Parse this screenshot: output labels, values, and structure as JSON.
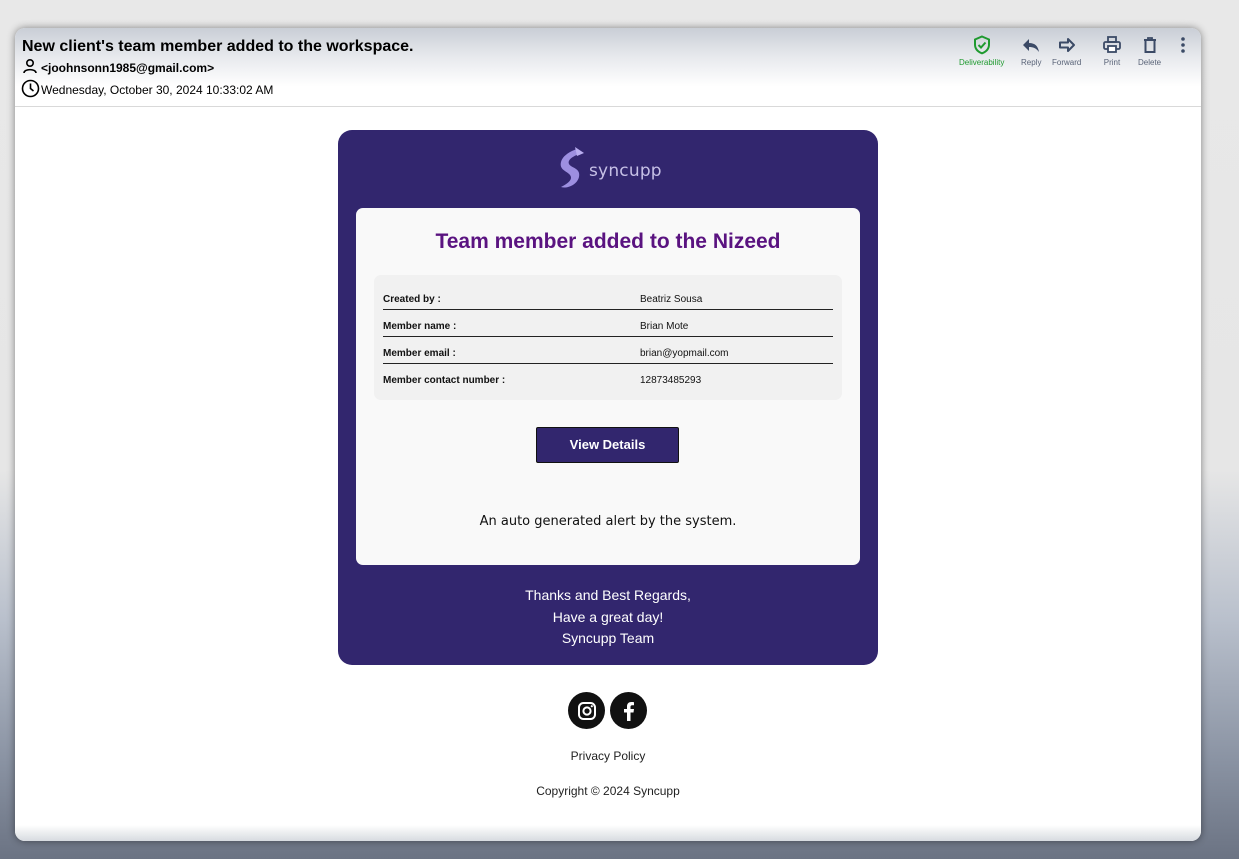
{
  "email": {
    "subject": "New client's team member added to the workspace.",
    "from": "<joohnsonn1985@gmail.com>",
    "date": "Wednesday, October 30, 2024 10:33:02 AM"
  },
  "toolbar": {
    "deliverability": "Deliverability",
    "reply": "Reply",
    "forward": "Forward",
    "print": "Print",
    "delete": "Delete"
  },
  "body": {
    "logo_text": "syncupp",
    "title": "Team member added to the Nizeed",
    "details": [
      {
        "label": "Created by :",
        "value": "Beatriz Sousa"
      },
      {
        "label": "Member name :",
        "value": "Brian Mote"
      },
      {
        "label": "Member email :",
        "value": "brian@yopmail.com"
      },
      {
        "label": "Member contact number :",
        "value": "12873485293"
      }
    ],
    "button_label": "View Details",
    "auto_note": "An auto generated alert by the system.",
    "thanks_line1": "Thanks and Best Regards,",
    "thanks_line2": "Have a great day!",
    "thanks_line3": "Syncupp Team"
  },
  "footer": {
    "privacy": "Privacy Policy",
    "copyright": "Copyright © 2024 Syncupp"
  },
  "icons": {
    "social": [
      "instagram-icon",
      "facebook-icon"
    ]
  },
  "colors": {
    "brand": "#32266e",
    "title": "#5a1380",
    "deliverability": "#1f9a2f"
  }
}
